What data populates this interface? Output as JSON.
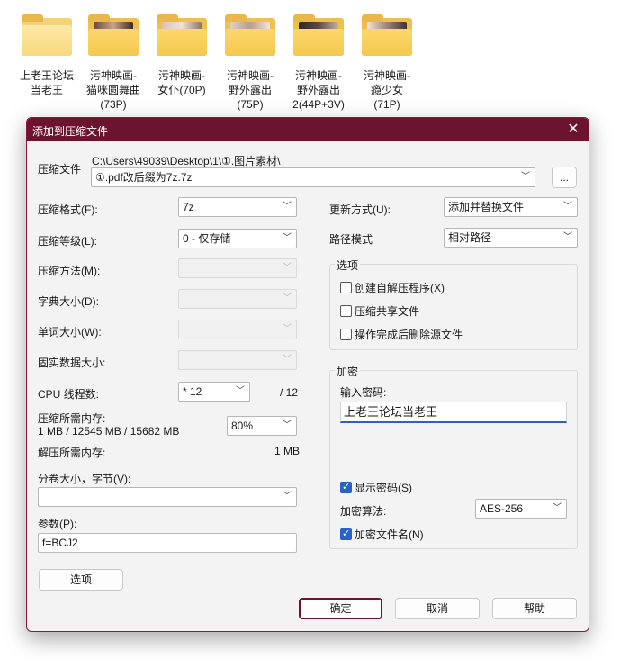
{
  "desktop": {
    "folders": [
      {
        "label_line1": "上老王论坛",
        "label_line2": "当老王",
        "label_line3": ""
      },
      {
        "label_line1": "污神映画-",
        "label_line2": "猫咪圆舞曲",
        "label_line3": "(73P)"
      },
      {
        "label_line1": "污神映画-",
        "label_line2": "女仆(70P)",
        "label_line3": ""
      },
      {
        "label_line1": "污神映画-",
        "label_line2": "野外露出",
        "label_line3": "(75P)"
      },
      {
        "label_line1": "污神映画-",
        "label_line2": "野外露出",
        "label_line3": "2(44P+3V)"
      },
      {
        "label_line1": "污神映画-",
        "label_line2": "瘾少女",
        "label_line3": "(71P)"
      }
    ]
  },
  "dialog": {
    "title": "添加到压缩文件",
    "close_symbol": "✕",
    "archive": {
      "label": "压缩文件",
      "path_line": "C:\\Users\\49039\\Desktop\\1\\①.图片素材\\",
      "name_value": "①.pdf改后缀为7z.7z",
      "browse_label": "..."
    },
    "left": {
      "format_label": "压缩格式(F):",
      "format_value": "7z",
      "level_label": "压缩等级(L):",
      "level_value": "0 - 仅存储",
      "method_label": "压缩方法(M):",
      "dict_label": "字典大小(D):",
      "word_label": "单词大小(W):",
      "solid_label": "固实数据大小:",
      "threads_label": "CPU 线程数:",
      "threads_value": "* 12",
      "threads_total": "/ 12",
      "mem_label": "压缩所需内存:",
      "mem_detail": "1 MB / 12545 MB / 15682 MB",
      "mem_percent": "80%",
      "decomp_label": "解压所需内存:",
      "decomp_value": "1 MB",
      "split_label": "分卷大小，字节(V):",
      "split_value": "",
      "params_label": "参数(P):",
      "params_value": "f=BCJ2",
      "options_button": "选项"
    },
    "right": {
      "update_label": "更新方式(U):",
      "update_value": "添加并替换文件",
      "path_label": "路径模式",
      "path_value": "相对路径",
      "options_group": "选项",
      "opt_sfx": "创建自解压程序(X)",
      "opt_shared": "压缩共享文件",
      "opt_delete": "操作完成后删除源文件",
      "encrypt_group": "加密",
      "password_label": "输入密码:",
      "password_value": "上老王论坛当老王",
      "show_password": "显示密码(S)",
      "enc_method_label": "加密算法:",
      "enc_method_value": "AES-256",
      "enc_names": "加密文件名(N)"
    },
    "buttons": {
      "ok": "确定",
      "cancel": "取消",
      "help": "帮助"
    }
  },
  "colors": {
    "titlebar": "#6b1430",
    "accent": "#2a62c7",
    "folder": "#f5c84d"
  },
  "icons": {
    "folder": "folder-icon",
    "dropdown": "chevron-down-icon",
    "close": "close-icon",
    "check": "checkmark-icon"
  }
}
